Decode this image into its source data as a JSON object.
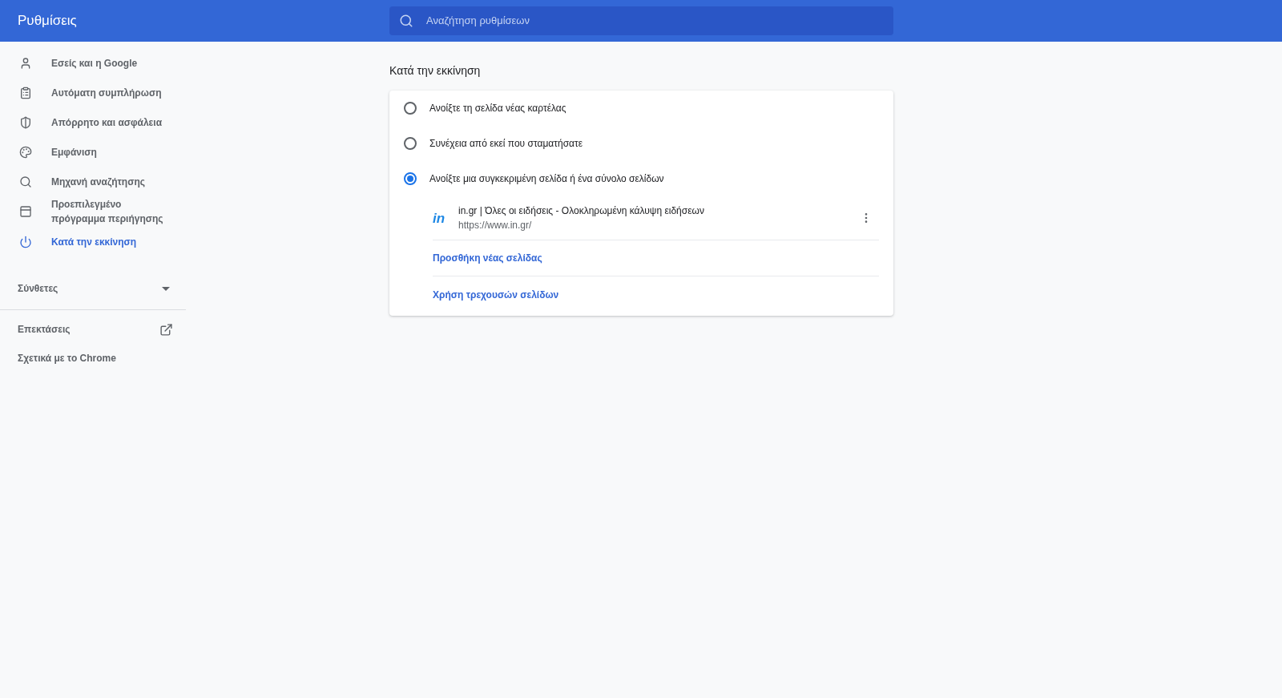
{
  "header": {
    "title": "Ρυθμίσεις",
    "search": {
      "placeholder": "Αναζήτηση ρυθμίσεων"
    }
  },
  "sidebar": {
    "items": [
      {
        "label": "Εσείς και η Google",
        "kind": "person",
        "selected": false
      },
      {
        "label": "Αυτόματη συμπλήρωση",
        "kind": "clipboard",
        "selected": false
      },
      {
        "label": "Απόρρητο και ασφάλεια",
        "kind": "shield",
        "selected": false
      },
      {
        "label": "Εμφάνιση",
        "kind": "palette",
        "selected": false
      },
      {
        "label": "Μηχανή αναζήτησης",
        "kind": "search",
        "selected": false
      },
      {
        "label": "Προεπιλεγμένο πρόγραμμα περιήγησης",
        "kind": "browser",
        "selected": false
      },
      {
        "label": "Κατά την εκκίνηση",
        "kind": "power",
        "selected": true
      }
    ],
    "advanced": {
      "label": "Σύνθετες",
      "expanded": false
    },
    "extensions": "Επεκτάσεις",
    "about": "Σχετικά με το Chrome"
  },
  "section": {
    "title": "Κατά την εκκίνηση",
    "options": [
      {
        "label": "Ανοίξτε τη σελίδα νέας καρτέλας",
        "selected": false
      },
      {
        "label": "Συνέχεια από εκεί που σταματήσατε",
        "selected": false
      },
      {
        "label": "Ανοίξτε μια συγκεκριμένη σελίδα ή ένα σύνολο σελίδων",
        "selected": true
      }
    ],
    "pages": [
      {
        "favicon": "in",
        "title": "in.gr | Όλες οι ειδήσεις - Ολοκληρωμένη κάλυψη ειδήσεων",
        "url": "https://www.in.gr/"
      }
    ],
    "links": [
      "Προσθήκη νέας σελίδας",
      "Χρήση τρεχουσών σελίδων"
    ]
  }
}
